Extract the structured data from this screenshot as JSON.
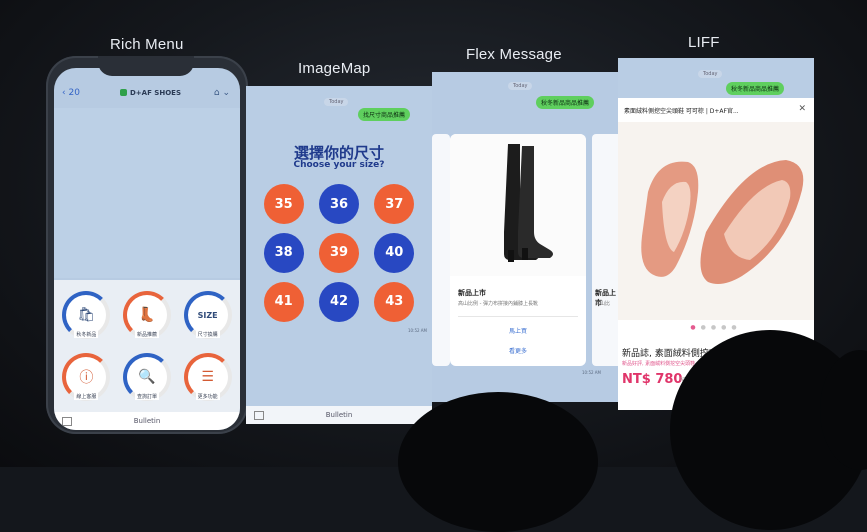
{
  "headings": {
    "rich_menu": "Rich Menu",
    "imagemap": "ImageMap",
    "flex": "Flex Message",
    "liff": "LIFF"
  },
  "rich_menu": {
    "back_label": "20",
    "title": "D+AF SHOES",
    "bottom_label": "Bulletin",
    "items": [
      {
        "label": "秋冬新品",
        "icon": "shopping-bag-icon",
        "color": "blue"
      },
      {
        "label": "新品推薦",
        "icon": "boot-icon",
        "color": "orange"
      },
      {
        "label": "尺寸換購",
        "icon": "size-icon",
        "color": "blue"
      },
      {
        "label": "線上客服",
        "icon": "info-icon",
        "color": "orange"
      },
      {
        "label": "查詢訂單",
        "icon": "order-search-icon",
        "color": "blue"
      },
      {
        "label": "更多功能",
        "icon": "list-icon",
        "color": "orange"
      }
    ]
  },
  "imagemap": {
    "date_chip": "Today",
    "bubble": "找尺寸商品推薦",
    "title": "選擇你的尺寸",
    "subtitle": "Choose your size?",
    "sizes": [
      {
        "value": "35",
        "color": "o"
      },
      {
        "value": "36",
        "color": "b"
      },
      {
        "value": "37",
        "color": "o"
      },
      {
        "value": "38",
        "color": "b"
      },
      {
        "value": "39",
        "color": "o"
      },
      {
        "value": "40",
        "color": "b"
      },
      {
        "value": "41",
        "color": "o"
      },
      {
        "value": "42",
        "color": "b"
      },
      {
        "value": "43",
        "color": "o"
      }
    ],
    "bottom_label": "Bulletin",
    "time": "10:52 AM"
  },
  "flex": {
    "date_chip": "Today",
    "bubble": "秋冬新品商品推薦",
    "card": {
      "title": "新品上市",
      "desc": "高山比例 - 彈力布拼接內鋪膝上長靴",
      "button1": "馬上買",
      "button2": "看更多"
    },
    "peek_title": "新品上市",
    "peek_desc": "高山比",
    "time": "10:52 AM"
  },
  "liff": {
    "date_chip": "Today",
    "bubble": "秋冬新品商品推薦",
    "title": "素面絨料側挖空尖頭鞋 可可棕 | D+AF官...",
    "name": "新品誌, 素面絨料側挖空尖",
    "desc": "新品好評, 素面絨料側挖空尖頭鞋",
    "price": "NT$ 780",
    "nt_label": "NT$1",
    "close": "✕"
  }
}
